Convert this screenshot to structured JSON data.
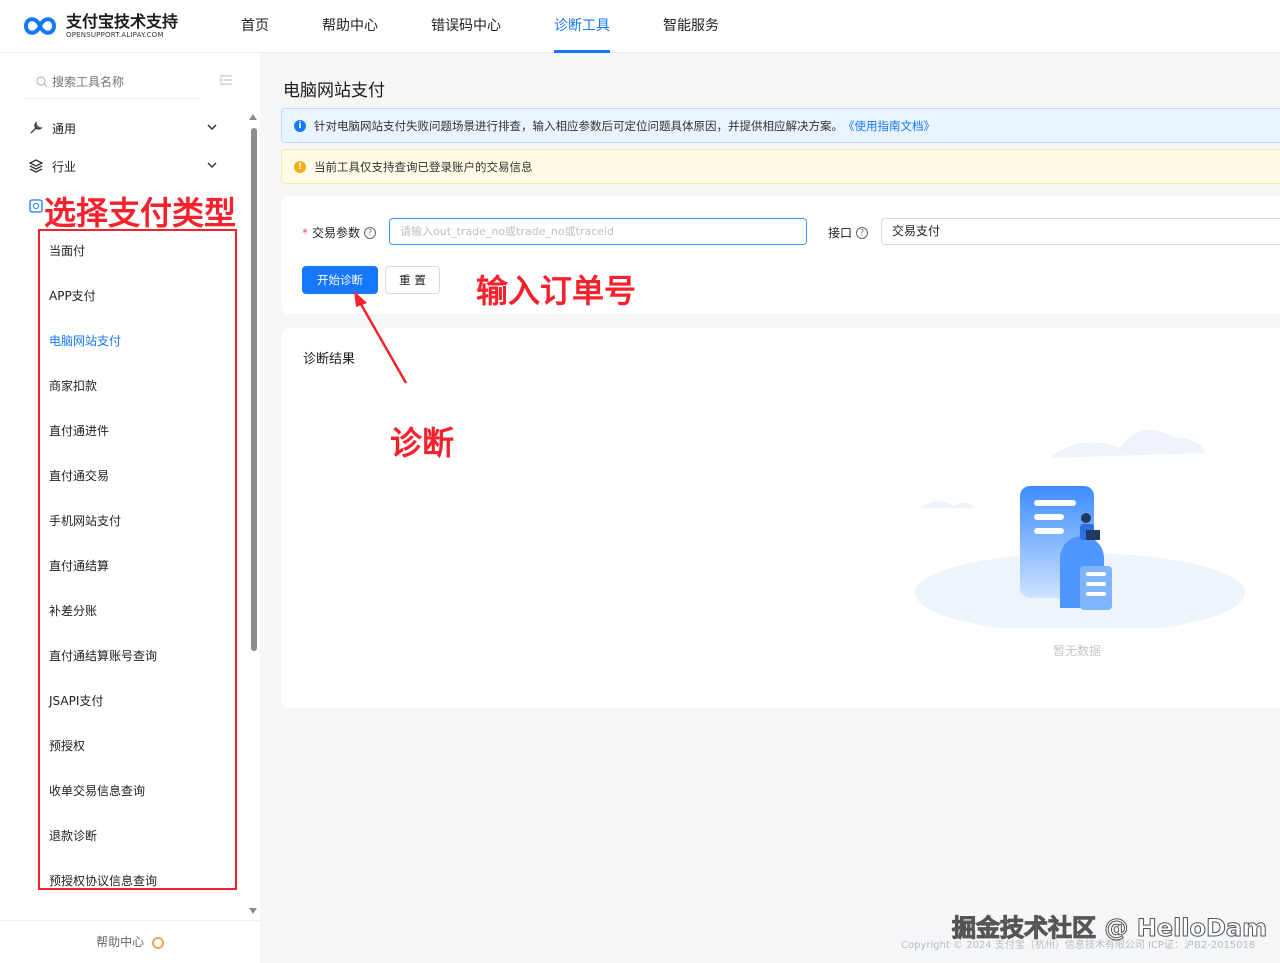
{
  "brand": {
    "title": "支付宝技术支持",
    "subtitle": "OPENSUPPORT.ALIPAY.COM"
  },
  "nav": [
    {
      "label": "首页"
    },
    {
      "label": "帮助中心"
    },
    {
      "label": "错误码中心"
    },
    {
      "label": "诊断工具"
    },
    {
      "label": "智能服务"
    }
  ],
  "sidebar": {
    "search_placeholder": "搜索工具名称",
    "groups": [
      {
        "label": "通用"
      },
      {
        "label": "行业"
      }
    ],
    "items": [
      {
        "label": "当面付"
      },
      {
        "label": "APP支付"
      },
      {
        "label": "电脑网站支付"
      },
      {
        "label": "商家扣款"
      },
      {
        "label": "直付通进件"
      },
      {
        "label": "直付通交易"
      },
      {
        "label": "手机网站支付"
      },
      {
        "label": "直付通结算"
      },
      {
        "label": "补差分账"
      },
      {
        "label": "直付通结算账号查询"
      },
      {
        "label": "JSAPI支付"
      },
      {
        "label": "预授权"
      },
      {
        "label": "收单交易信息查询"
      },
      {
        "label": "退款诊断"
      },
      {
        "label": "预授权协议信息查询"
      }
    ],
    "help_label": "帮助中心"
  },
  "main": {
    "title": "电脑网站支付",
    "info_text": "针对电脑网站支付失败问题场景进行排查，输入相应参数后可定位问题具体原因，并提供相应解决方案。",
    "info_link": "《使用指南文档》",
    "warn_text": "当前工具仅支持查询已登录账户的交易信息",
    "form": {
      "param_label": "交易参数",
      "param_placeholder": "请输入out_trade_no或trade_no或traceid",
      "api_label": "接口",
      "api_value": "交易支付",
      "start_label": "开始诊断",
      "reset_label": "重 置"
    },
    "result_title": "诊断结果",
    "empty_text": "暂无数据"
  },
  "copyright": "Copyright © 2024 支付宝（杭州）信息技术有限公司 ICP证：沪B2-2015018",
  "annotations": {
    "select_type": "选择支付类型",
    "input_order": "输入订单号",
    "diagnose": "诊断"
  },
  "watermark": "掘金技术社区 @ HelloDam",
  "colors": {
    "accent": "#1677ff",
    "annotation": "#f5222d"
  }
}
